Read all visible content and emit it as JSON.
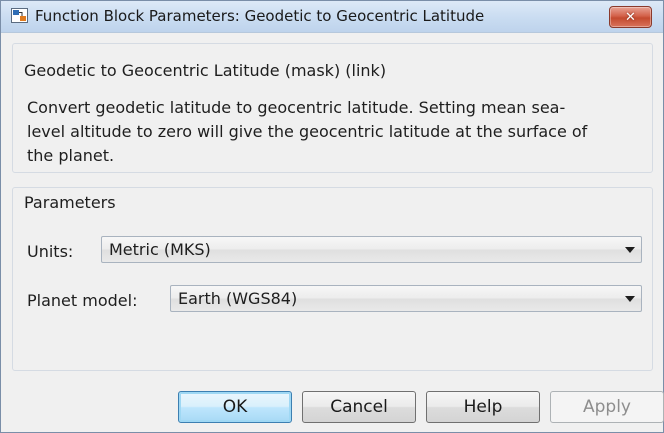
{
  "window": {
    "title": "Function Block Parameters: Geodetic to Geocentric Latitude"
  },
  "description_group": {
    "title": "Geodetic to Geocentric Latitude (mask) (link)",
    "lines": [
      "Convert geodetic latitude to geocentric latitude. Setting mean sea-",
      "level altitude to zero will give the geocentric latitude at the surface of",
      "the planet."
    ]
  },
  "parameters_group": {
    "title": "Parameters",
    "units": {
      "label": "Units:",
      "value": "Metric (MKS)"
    },
    "planet_model": {
      "label": "Planet model:",
      "value": "Earth (WGS84)"
    }
  },
  "buttons": {
    "ok": "OK",
    "cancel": "Cancel",
    "help": "Help",
    "apply": "Apply"
  },
  "icons": {
    "window_icon": "simulink-block-icon",
    "close_icon": "close-icon",
    "dropdown_icon": "chevron-down-icon"
  },
  "colors": {
    "titlebar": "#c9dcf1",
    "close_button": "#c44a2f",
    "default_button_border": "#3c7fb1",
    "dialog_background": "#f0f0f0"
  }
}
